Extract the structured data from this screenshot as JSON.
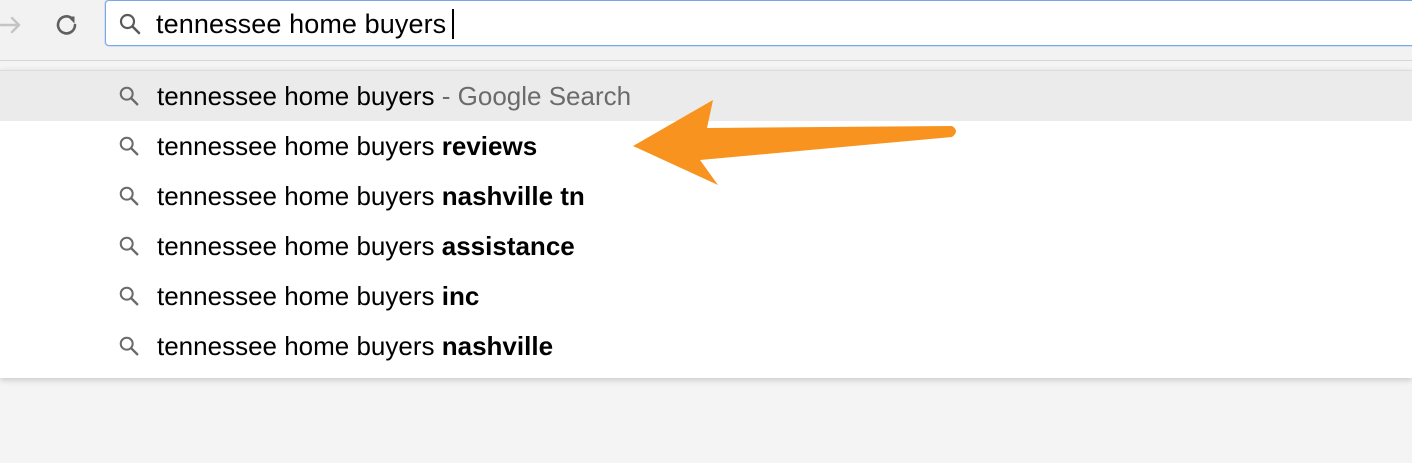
{
  "toolbar": {
    "forward_icon": "arrow-right-icon",
    "reload_icon": "reload-icon"
  },
  "omnibox": {
    "icon": "search-icon",
    "value": "tennessee home buyers"
  },
  "suggestions": [
    {
      "base": "tennessee home buyers",
      "bold": "",
      "separator": "-",
      "suffix": "Google Search",
      "selected": true
    },
    {
      "base": "tennessee home buyers",
      "bold": "reviews",
      "separator": "",
      "suffix": "",
      "selected": false
    },
    {
      "base": "tennessee home buyers",
      "bold": "nashville tn",
      "separator": "",
      "suffix": "",
      "selected": false
    },
    {
      "base": "tennessee home buyers",
      "bold": "assistance",
      "separator": "",
      "suffix": "",
      "selected": false
    },
    {
      "base": "tennessee home buyers",
      "bold": "inc",
      "separator": "",
      "suffix": "",
      "selected": false
    },
    {
      "base": "tennessee home buyers",
      "bold": "nashville",
      "separator": "",
      "suffix": "",
      "selected": false
    }
  ],
  "annotation": {
    "type": "arrow",
    "color": "#f7931e",
    "points_to": "tennessee home buyers reviews"
  }
}
